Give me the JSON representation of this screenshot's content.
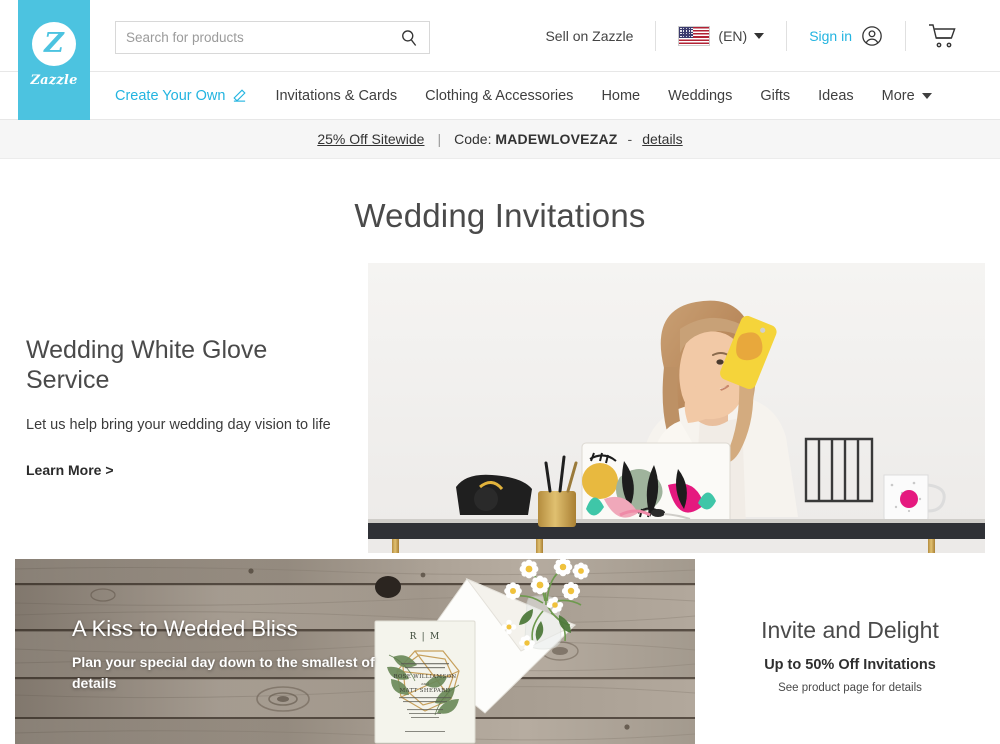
{
  "brand": {
    "name": "Zazzle",
    "logo_letter": "Z",
    "accent_color": "#4cc3e0",
    "link_color": "#23b4e0"
  },
  "header": {
    "search": {
      "placeholder": "Search for products",
      "value": "",
      "icon": "search-icon"
    },
    "sell_label": "Sell on Zazzle",
    "language": {
      "flag": "us-flag-icon",
      "label": "(EN)",
      "caret": "chevron-down-icon"
    },
    "signin_label": "Sign in",
    "account_icon": "user-circle-icon",
    "cart_icon": "shopping-cart-icon"
  },
  "nav": {
    "items": [
      {
        "label": "Create Your Own",
        "accent": true,
        "icon": "pencil-icon"
      },
      {
        "label": "Invitations & Cards",
        "accent": false,
        "icon": ""
      },
      {
        "label": "Clothing & Accessories",
        "accent": false,
        "icon": ""
      },
      {
        "label": "Home",
        "accent": false,
        "icon": ""
      },
      {
        "label": "Weddings",
        "accent": false,
        "icon": ""
      },
      {
        "label": "Gifts",
        "accent": false,
        "icon": ""
      },
      {
        "label": "Ideas",
        "accent": false,
        "icon": ""
      },
      {
        "label": "More",
        "accent": false,
        "icon": "chevron-down-icon"
      }
    ]
  },
  "promo_bar": {
    "offer": "25% Off Sitewide",
    "separator": "|",
    "code_label": "Code:",
    "code": "MADEWLOVEZAZ",
    "dash": "-",
    "details_label": "details"
  },
  "page": {
    "title": "Wedding Invitations"
  },
  "hero": {
    "heading": "Wedding White Glove Service",
    "body": "Let us help bring your wedding day vision to life",
    "cta": "Learn More >",
    "image_alt": "woman-on-phone-at-desk-photo"
  },
  "bottom": {
    "wood_banner": {
      "heading": "A Kiss to Wedded Bliss",
      "body": "Plan your special day down to the smallest of details",
      "image_alt": "wedding-invitation-on-wood-photo",
      "invitation_card": {
        "monogram": "R | M",
        "bride": "ROSE WILLIAMSON",
        "groom": "MATT SHEPARD"
      }
    },
    "right_promo": {
      "heading": "Invite and Delight",
      "subheading": "Up to 50% Off Invitations",
      "fine_print": "See product page for details"
    }
  }
}
